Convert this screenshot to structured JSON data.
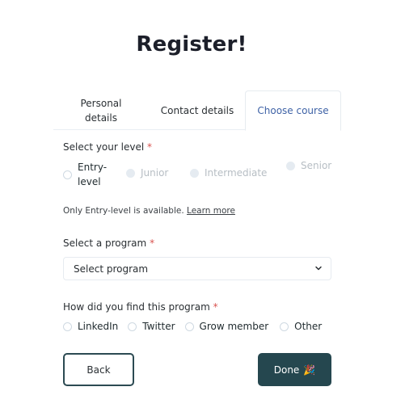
{
  "page": {
    "title": "Register!"
  },
  "tabs": [
    {
      "label": "Personal details",
      "active": false
    },
    {
      "label": "Contact details",
      "active": false
    },
    {
      "label": "Choose course",
      "active": true
    }
  ],
  "level": {
    "label": "Select your level",
    "required_mark": "*",
    "options": [
      {
        "label": "Entry-level",
        "disabled": false,
        "selected": false
      },
      {
        "label": "Junior",
        "disabled": true,
        "selected": false
      },
      {
        "label": "Intermediate",
        "disabled": true,
        "selected": false
      },
      {
        "label": "Senior",
        "disabled": true,
        "selected": false
      }
    ],
    "help_text": "Only Entry-level is available.",
    "help_link": "Learn more"
  },
  "program": {
    "label": "Select a program",
    "required_mark": "*",
    "selected": "Select program",
    "icon": "chevron-down-icon"
  },
  "source": {
    "label": "How did you find this program",
    "required_mark": "*",
    "options": [
      {
        "label": "LinkedIn",
        "selected": false
      },
      {
        "label": "Twitter",
        "selected": false
      },
      {
        "label": "Grow member",
        "selected": false
      },
      {
        "label": "Other",
        "selected": false
      }
    ]
  },
  "actions": {
    "back_label": "Back",
    "done_label": "Done",
    "done_icon": "🎉"
  },
  "colors": {
    "primary": "#25474f",
    "active_tab": "#3e62a6",
    "required": "#d9534f"
  }
}
